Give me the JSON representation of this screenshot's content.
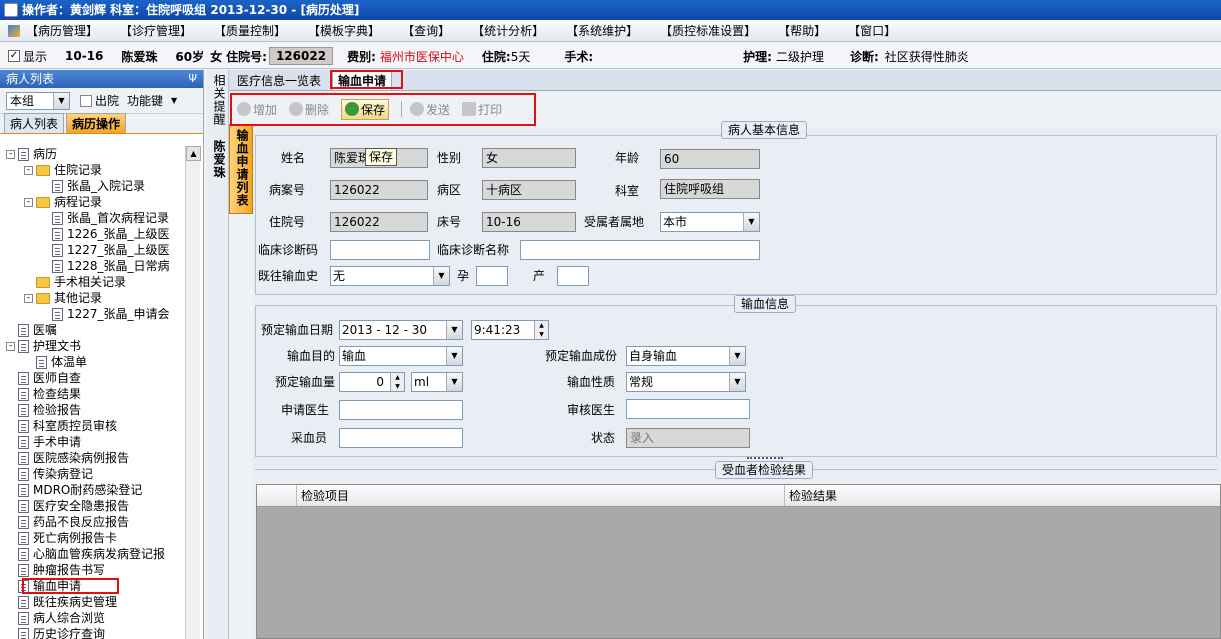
{
  "title": "操作者：黄剑辉   科室：住院呼吸组   2013-12-30 - [病历处理]",
  "menu": [
    "【病历管理】",
    "【诊疗管理】",
    "【质量控制】",
    "【模板字典】",
    "【查询】",
    "【统计分析】",
    "【系统维护】",
    "【质控标准设置】",
    "【帮助】",
    "【窗口】"
  ],
  "infobar": {
    "show_label": "显示",
    "bed": "10-16",
    "name": "陈爱珠",
    "age": "60岁",
    "sex": "女",
    "inpatient_label": "住院号:",
    "inpatient_no": "126022",
    "fee_label": "费别:",
    "fee_value": "福州市医保中心",
    "stay_label": "住院:",
    "stay_value": "5天",
    "surgery_label": "手术:",
    "nursing_label": "护理:",
    "nursing_value": "二级护理",
    "diag_label": "诊断:",
    "diag_value": "社区获得性肺炎"
  },
  "left": {
    "title": "病人列表",
    "pin": "Ψ",
    "group": "本组",
    "discharged_label": "出院",
    "func_label": "功能键",
    "tabs": [
      "病人列表",
      "病历操作"
    ],
    "tree": [
      {
        "t": "病历",
        "lvl": 0,
        "type": "doc",
        "exp": "-"
      },
      {
        "t": "住院记录",
        "lvl": 1,
        "type": "folder",
        "exp": "-"
      },
      {
        "t": "张晶_入院记录",
        "lvl": 2,
        "type": "doc"
      },
      {
        "t": "病程记录",
        "lvl": 1,
        "type": "folder",
        "exp": "-"
      },
      {
        "t": "张晶_首次病程记录",
        "lvl": 2,
        "type": "doc"
      },
      {
        "t": "1226_张晶_上级医",
        "lvl": 2,
        "type": "doc"
      },
      {
        "t": "1227_张晶_上级医",
        "lvl": 2,
        "type": "doc"
      },
      {
        "t": "1228_张晶_日常病",
        "lvl": 2,
        "type": "doc"
      },
      {
        "t": "手术相关记录",
        "lvl": 1,
        "type": "folder"
      },
      {
        "t": "其他记录",
        "lvl": 1,
        "type": "folder",
        "exp": "-"
      },
      {
        "t": "1227_张晶_申请会",
        "lvl": 2,
        "type": "doc"
      },
      {
        "t": "医嘱",
        "lvl": 0,
        "type": "doc"
      },
      {
        "t": "护理文书",
        "lvl": 0,
        "type": "doc",
        "exp": "-"
      },
      {
        "t": "体温单",
        "lvl": 1,
        "type": "doc"
      },
      {
        "t": "医师自查",
        "lvl": 0,
        "type": "doc"
      },
      {
        "t": "检查结果",
        "lvl": 0,
        "type": "doc"
      },
      {
        "t": "检验报告",
        "lvl": 0,
        "type": "doc"
      },
      {
        "t": "科室质控员审核",
        "lvl": 0,
        "type": "doc"
      },
      {
        "t": "手术申请",
        "lvl": 0,
        "type": "doc"
      },
      {
        "t": "医院感染病例报告",
        "lvl": 0,
        "type": "doc"
      },
      {
        "t": "传染病登记",
        "lvl": 0,
        "type": "doc"
      },
      {
        "t": "MDRO耐药感染登记",
        "lvl": 0,
        "type": "doc"
      },
      {
        "t": "医疗安全隐患报告",
        "lvl": 0,
        "type": "doc"
      },
      {
        "t": "药品不良反应报告",
        "lvl": 0,
        "type": "doc"
      },
      {
        "t": "死亡病例报告卡",
        "lvl": 0,
        "type": "doc"
      },
      {
        "t": "心脑血管疾病发病登记报",
        "lvl": 0,
        "type": "doc"
      },
      {
        "t": "肿瘤报告书写",
        "lvl": 0,
        "type": "doc"
      },
      {
        "t": "输血申请",
        "lvl": 0,
        "type": "doc"
      },
      {
        "t": "既往疾病史管理",
        "lvl": 0,
        "type": "doc"
      },
      {
        "t": "病人综合浏览",
        "lvl": 0,
        "type": "doc"
      },
      {
        "t": "历史诊疗查询",
        "lvl": 0,
        "type": "doc"
      }
    ]
  },
  "side": {
    "reminder": "相关提醒",
    "patient": "陈爱珠",
    "list": "输血申请列表"
  },
  "tabs": [
    "医疗信息一览表",
    "输血申请"
  ],
  "toolbar": {
    "add": "增加",
    "del": "删除",
    "save": "保存",
    "send": "发送",
    "print": "打印"
  },
  "tooltip": "保存",
  "basic": {
    "legend": "病人基本信息",
    "name_l": "姓名",
    "name": "陈爱珠",
    "sex_l": "性别",
    "sex": "女",
    "age_l": "年龄",
    "age": "60",
    "case_l": "病案号",
    "case": "126022",
    "ward_l": "病区",
    "ward": "十病区",
    "dept_l": "科室",
    "dept": "住院呼吸组",
    "inp_l": "住院号",
    "inp": "126022",
    "bed_l": "床号",
    "bed": "10-16",
    "region_l": "受属者属地",
    "region": "本市",
    "dxcode_l": "临床诊断码",
    "dxname_l": "临床诊断名称",
    "hist_l": "既往输血史",
    "hist": "无",
    "preg_l": "孕",
    "birth_l": "产"
  },
  "transfusion": {
    "legend": "输血信息",
    "date_l": "预定输血日期",
    "date": "2013 - 12 - 30",
    "time": "9:41:23",
    "purpose_l": "输血目的",
    "purpose": "输血",
    "comp_l": "预定输血成份",
    "comp": "自身输血",
    "amount_l": "预定输血量",
    "amount": "0",
    "unit": "ml",
    "nature_l": "输血性质",
    "nature": "常规",
    "appdoc_l": "申请医生",
    "revdoc_l": "审核医生",
    "collector_l": "采血员",
    "status_l": "状态",
    "status": "录入"
  },
  "results": {
    "legend": "受血者检验结果",
    "col1": "检验项目",
    "col2": "检验结果"
  },
  "colors": {
    "fee": "#d01010",
    "accent": "#f4a522",
    "highlight": "#e01010"
  }
}
